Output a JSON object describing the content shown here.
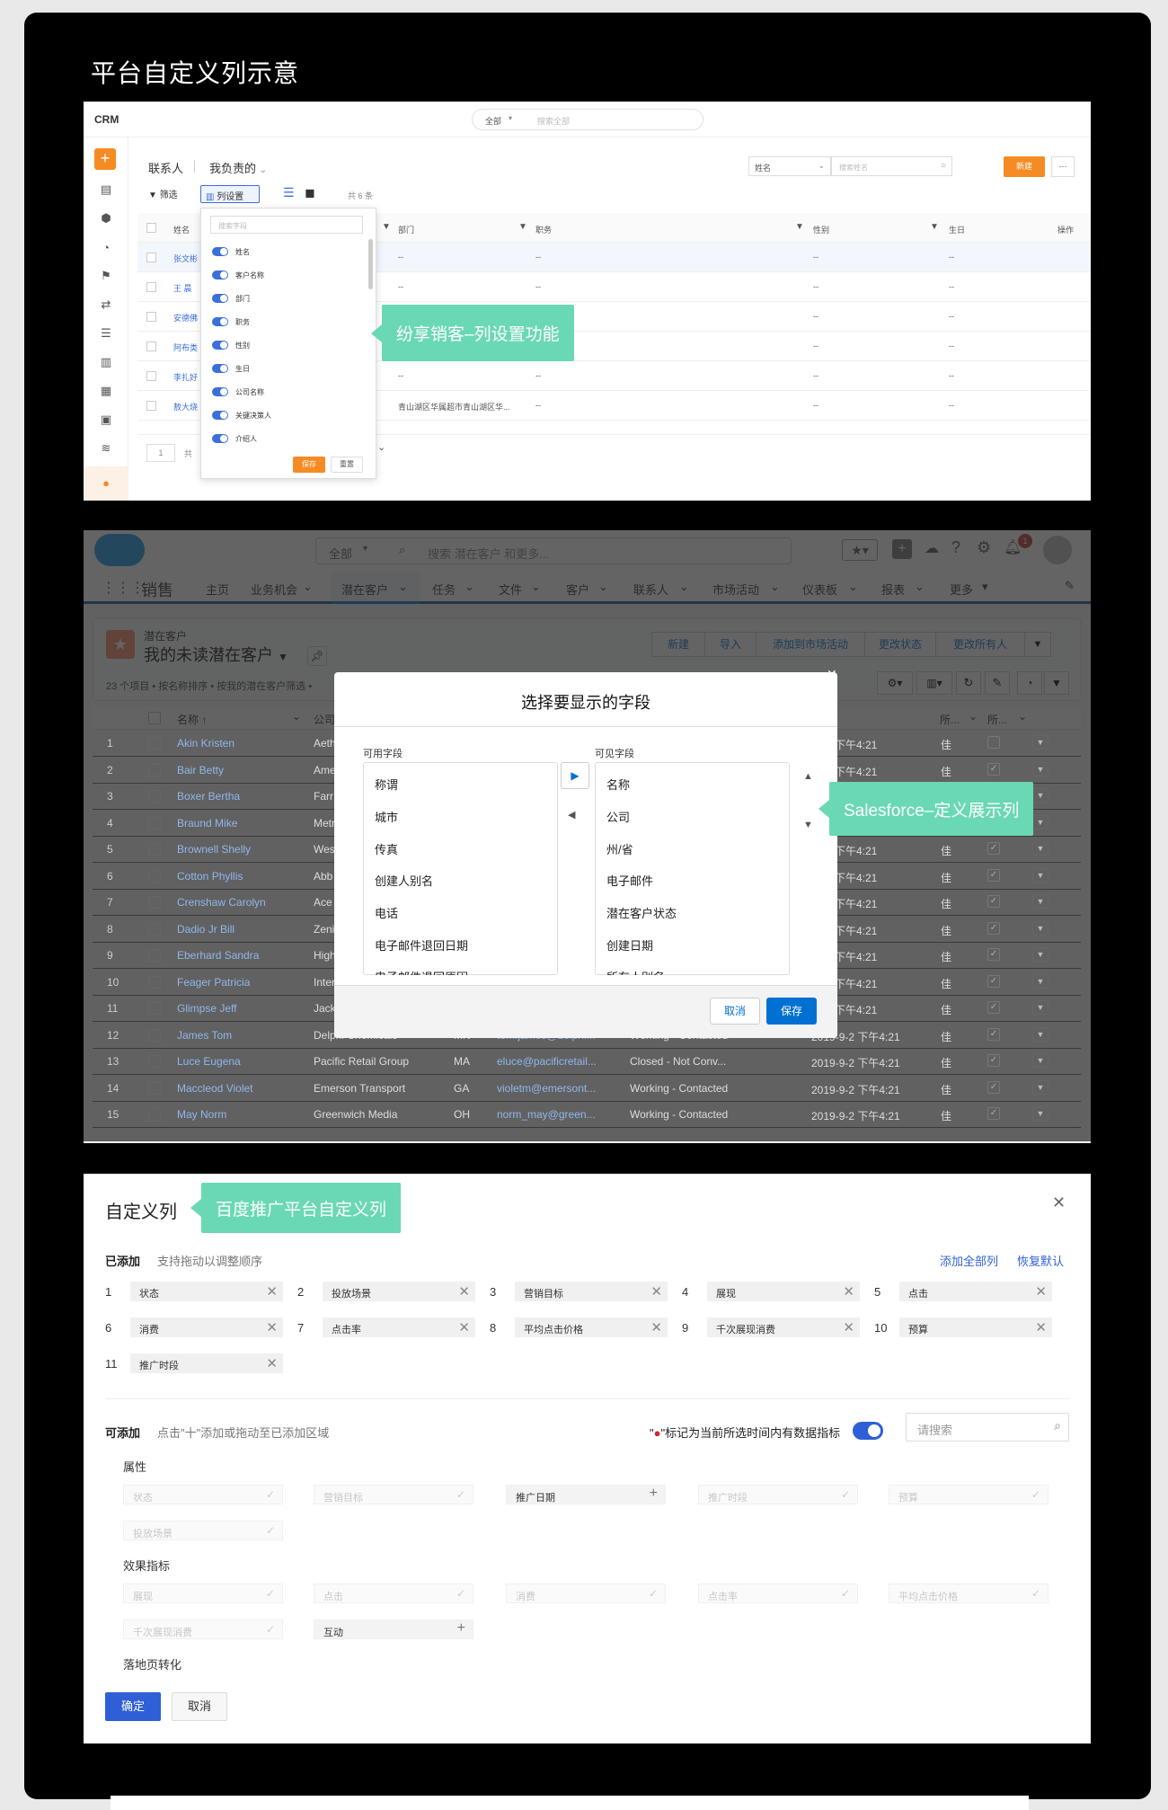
{
  "page_title": "平台自定义列示意",
  "crm": {
    "logo": "CRM",
    "search_scope": "全部",
    "search_placeholder": "搜索全部",
    "breadcrumb_root": "联系人",
    "view_name": "我负责的",
    "filter_label": "筛选",
    "column_settings_label": "列设置",
    "count_text": "共 6 条",
    "field_select": "姓名",
    "field_search_placeholder": "搜索姓名",
    "new_button": "新建",
    "more_button": "···",
    "headers": [
      "姓名",
      "部门",
      "职务",
      "性别",
      "生日",
      "操作"
    ],
    "names": [
      "张文彬",
      "王 晨",
      "安德佛",
      "阿布类",
      "李扎好",
      "敖大烧"
    ],
    "rows": [
      {
        "dept": "--",
        "title": "--",
        "gender": "--",
        "birthday": "--"
      },
      {
        "dept": "--",
        "title": "--",
        "gender": "--",
        "birthday": "--"
      },
      {
        "dept": "",
        "title": "",
        "gender": "--",
        "birthday": "--"
      },
      {
        "dept": "",
        "title": "",
        "gender": "--",
        "birthday": "--"
      },
      {
        "dept": "--",
        "title": "--",
        "gender": "--",
        "birthday": "--"
      },
      {
        "dept": "青山湖区华属超市青山湖区华...",
        "title": "--",
        "gender": "--",
        "birthday": "--"
      }
    ],
    "popup_search_placeholder": "搜索字段",
    "popup_fields": [
      "姓名",
      "客户名称",
      "部门",
      "职务",
      "性别",
      "生日",
      "公司名称",
      "关键决策人",
      "介绍人"
    ],
    "save_label": "保存",
    "reset_label": "重置",
    "pager": "1",
    "pager_total": "共",
    "callout": "纷享销客–列设置功能"
  },
  "sf": {
    "search_scope": "全部",
    "search_placeholder": "搜索 潜在客户 和更多...",
    "app_name": "销售",
    "nav_items": [
      "主页",
      "业务机会",
      "潜在客户",
      "任务",
      "文件",
      "客户",
      "联系人",
      "市场活动",
      "仪表板",
      "报表",
      "更多"
    ],
    "notification_count": "1",
    "object_label": "潜在客户",
    "list_view": "我的未读潜在客户",
    "list_meta": "23 个项目 • 按名称排序 • 按我的潜在客户筛选 •",
    "actions": [
      "新建",
      "导入",
      "添加到市场活动",
      "更改状态",
      "更改所有人"
    ],
    "col_name": "名称 ↑",
    "col_company": "公司",
    "col_owner1": "所...",
    "col_owner2": "所...",
    "rows": [
      {
        "n": "1",
        "name": "Akin Kristen",
        "company": "Aeth",
        "state": "",
        "email": "",
        "status": "",
        "date": "-2 下午4:21",
        "alias": "佳"
      },
      {
        "n": "2",
        "name": "Bair Betty",
        "company": "Ame",
        "state": "",
        "email": "",
        "status": "",
        "date": "-2 下午4:21",
        "alias": "佳"
      },
      {
        "n": "3",
        "name": "Boxer Bertha",
        "company": "Farr",
        "state": "",
        "email": "",
        "status": "",
        "date": "-2 下午4:21",
        "alias": "佳"
      },
      {
        "n": "4",
        "name": "Braund Mike",
        "company": "Metr",
        "state": "",
        "email": "",
        "status": "",
        "date": "-2 下午4:21",
        "alias": "佳"
      },
      {
        "n": "5",
        "name": "Brownell Shelly",
        "company": "Wes",
        "state": "",
        "email": "",
        "status": "",
        "date": "-2 下午4:21",
        "alias": "佳"
      },
      {
        "n": "6",
        "name": "Cotton Phyllis",
        "company": "Abb",
        "state": "",
        "email": "",
        "status": "",
        "date": "-2 下午4:21",
        "alias": "佳"
      },
      {
        "n": "7",
        "name": "Crenshaw Carolyn",
        "company": "Ace",
        "state": "",
        "email": "",
        "status": "",
        "date": "-2 下午4:21",
        "alias": "佳"
      },
      {
        "n": "8",
        "name": "Dadio Jr Bill",
        "company": "Zeni",
        "state": "",
        "email": "",
        "status": "",
        "date": "-2 下午4:21",
        "alias": "佳"
      },
      {
        "n": "9",
        "name": "Eberhard Sandra",
        "company": "High",
        "state": "",
        "email": "",
        "status": "",
        "date": "-2 下午4:21",
        "alias": "佳"
      },
      {
        "n": "10",
        "name": "Feager Patricia",
        "company": "Inter",
        "state": "",
        "email": "",
        "status": "",
        "date": "-2 下午4:21",
        "alias": "佳"
      },
      {
        "n": "11",
        "name": "Glimpse Jeff",
        "company": "Jack",
        "state": "",
        "email": "",
        "status": "",
        "date": "-2 下午4:21",
        "alias": "佳"
      },
      {
        "n": "12",
        "name": "James Tom",
        "company": "Delphi Chemicals",
        "state": "MN",
        "email": "tom.james@delphi...",
        "status": "Working - Contacted",
        "date": "2019-9-2 下午4:21",
        "alias": "佳"
      },
      {
        "n": "13",
        "name": "Luce Eugena",
        "company": "Pacific Retail Group",
        "state": "MA",
        "email": "eluce@pacificretail...",
        "status": "Closed - Not Conv...",
        "date": "2019-9-2 下午4:21",
        "alias": "佳"
      },
      {
        "n": "14",
        "name": "Maccleod Violet",
        "company": "Emerson Transport",
        "state": "GA",
        "email": "violetm@emersont...",
        "status": "Working - Contacted",
        "date": "2019-9-2 下午4:21",
        "alias": "佳"
      },
      {
        "n": "15",
        "name": "May Norm",
        "company": "Greenwich Media",
        "state": "OH",
        "email": "norm_may@green...",
        "status": "Working - Contacted",
        "date": "2019-9-2 下午4:21",
        "alias": "佳"
      }
    ],
    "dialog": {
      "title": "选择要显示的字段",
      "available_label": "可用字段",
      "visible_label": "可见字段",
      "available": [
        "称谓",
        "城市",
        "传真",
        "创建人别名",
        "电话",
        "电子邮件退回日期",
        "电子邮件退回原因"
      ],
      "visible": [
        "名称",
        "公司",
        "州/省",
        "电子邮件",
        "潜在客户状态",
        "创建日期",
        "所有人别名"
      ],
      "cancel": "取消",
      "save": "保存"
    },
    "callout": "Salesforce–定义展示列"
  },
  "baidu": {
    "title": "自定义列",
    "callout": "百度推广平台自定义列",
    "added_label": "已添加",
    "added_hint": "支持拖动以调整顺序",
    "add_all": "添加全部列",
    "restore_default": "恢复默认",
    "added": [
      {
        "n": "1",
        "label": "状态"
      },
      {
        "n": "2",
        "label": "投放场景"
      },
      {
        "n": "3",
        "label": "营销目标"
      },
      {
        "n": "4",
        "label": "展现"
      },
      {
        "n": "5",
        "label": "点击"
      },
      {
        "n": "6",
        "label": "消费"
      },
      {
        "n": "7",
        "label": "点击率"
      },
      {
        "n": "8",
        "label": "平均点击价格"
      },
      {
        "n": "9",
        "label": "千次展现消费"
      },
      {
        "n": "10",
        "label": "预算"
      },
      {
        "n": "11",
        "label": "推广时段"
      }
    ],
    "addable_label": "可添加",
    "addable_hint": "点击\"十\"添加或拖动至已添加区域",
    "indicator_prefix": "\"",
    "indicator_text": "\"标记为当前所选时间内有数据指标",
    "search_placeholder": "请搜索",
    "group_attr": "属性",
    "attr_items": [
      "状态",
      "营销目标",
      "推广日期",
      "推广时段",
      "预算",
      "投放场景"
    ],
    "group_effect": "效果指标",
    "effect_items": [
      "展现",
      "点击",
      "消费",
      "点击率",
      "平均点击价格",
      "千次展现消费",
      "互动"
    ],
    "group_landing": "落地页转化",
    "confirm": "确定",
    "cancel": "取消",
    "accent": "#2f5fd6"
  }
}
